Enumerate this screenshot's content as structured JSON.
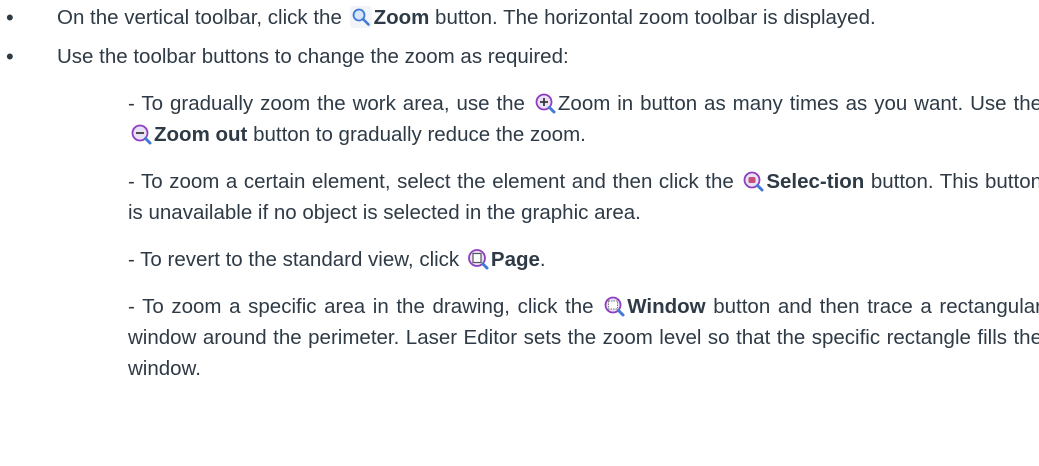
{
  "bullets": [
    {
      "marker": "•",
      "before": "On the vertical toolbar, click the ",
      "icon": "zoom-magnifier-icon",
      "bold": "Zoom",
      "after": " button. The horizontal zoom toolbar is displayed."
    },
    {
      "marker": "•",
      "text": "Use the toolbar buttons to change the zoom as required:"
    }
  ],
  "subitems": [
    {
      "before": "- To gradually zoom the work area, use the ",
      "icon": "zoom-in-icon",
      "label": "Zoom in",
      "middle": " button as many times as you want. Use the ",
      "icon2": "zoom-out-icon",
      "bold2": "Zoom out",
      "after": " button to gradually reduce the zoom."
    },
    {
      "before": "- To zoom a certain element, select the element and then click the ",
      "icon": "zoom-selection-icon",
      "bold": "Selec-tion",
      "after": " button. This button is unavailable if no object is selected in the graphic area."
    },
    {
      "before": "- To revert to the standard view, click ",
      "icon": "zoom-page-icon",
      "bold": "Page",
      "after": "."
    },
    {
      "before": "- To zoom a specific area in the drawing, click the ",
      "icon": "zoom-window-icon",
      "bold": "Window",
      "after": " button and then trace a rectangular window around the perimeter. Laser Editor sets the zoom level so that the specific rectangle fills the window."
    }
  ],
  "colors": {
    "text": "#2e3a46",
    "icon_blue": "#3f7ad6",
    "icon_purple": "#8e3fbf",
    "icon_lens": "#e9e2f5"
  }
}
